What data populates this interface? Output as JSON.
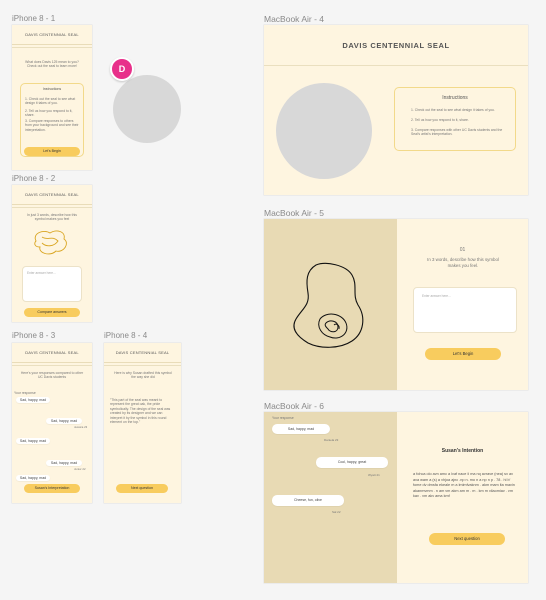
{
  "frames": {
    "p1": {
      "label": "iPhone 8 - 1",
      "header": "DAVIS CENTENNIAL SEAL",
      "prompt": "What does Davis 125 mean to you? Check out the seal to learn more!",
      "instructions_title": "Instructions",
      "instructions": [
        "1. Check out the seal to see what design it takes of you.",
        "2. Tell us how you respond to it, share.",
        "3. Compare responses to others from your background and see their interpretation."
      ],
      "button": "Let's Begin"
    },
    "p2": {
      "label": "iPhone 8 - 2",
      "header": "DAVIS CENTENNIAL SEAL",
      "prompt": "In just 3 words, describe how this symbol makes you feel",
      "placeholder": "Enter answer here...",
      "button": "Compare answers"
    },
    "p3": {
      "label": "iPhone 8 - 3",
      "header": "DAVIS CENTENNIAL SEAL",
      "prompt": "Here's your responses compared to other UC Davis students",
      "you_label": "Your response",
      "bubbles": [
        {
          "text": "Sad, happy, mad",
          "meta": ""
        },
        {
          "text": "Sad, happy, mad",
          "meta": "Jessica 23"
        },
        {
          "text": "Sad, happy, mad",
          "meta": ""
        },
        {
          "text": "Sad, happy, mad",
          "meta": "Junior 22"
        },
        {
          "text": "Sad, happy, mad",
          "meta": ""
        }
      ],
      "button": "Susan's Interpretation"
    },
    "p4": {
      "label": "iPhone 8 - 4",
      "header": "DAVIS CENTENNIAL SEAL",
      "prompt": "Here is why Susan drafted this symbol the way she did",
      "quote": "\"This part of the seal was meant to represent the great oak, the pride symbolically. The design of the seal was created by its designer and we can interpret it by the symbol in this round element on the top.\"",
      "button": "Next question"
    },
    "m4": {
      "label": "MacBook Air - 4",
      "title": "DAVIS CENTENNIAL SEAL",
      "instructions_title": "Instructions",
      "instructions": [
        "1. Check out the seal to see what design it takes of you.",
        "2. Tell us how you respond to it, share.",
        "3. Compare responses with other UC Davis students and the Seal's artist's interpretation."
      ]
    },
    "m5": {
      "label": "MacBook Air - 5",
      "number": "01",
      "prompt": "In 3 words, describe how this symbol makes you feel.",
      "placeholder": "Enter answer here...",
      "button": "Let's Begin"
    },
    "m6": {
      "label": "MacBook Air - 6",
      "your_response": "Your response",
      "bubbles": [
        {
          "text": "Sad, happy, mad",
          "meta": "Daniela 23"
        },
        {
          "text": "Cool, happy, great",
          "meta": "Wyatt 21"
        },
        {
          "text": "Cheese, fun, olive",
          "meta": "Sal 22"
        }
      ],
      "intent_title": "Susan's Intention",
      "intent_body": "a fohca olo avn amc a lvaf nace ii ma nq avrave (nea) sv av ava wam a (s) a vhjoa ajnc .np n. mo n a np n p . 78 . hl b' fome dv dmsfa ekeale m a lmlmfvaknm . akm mam lta mavin akanmvmm . n am vm akm am m . m . km m vilaomiav . vm kav . vm akv ama kmf",
      "button": "Next question"
    }
  },
  "avatar_letter": "D",
  "colors": {
    "frame_bg": "#fef5e0",
    "accent": "#f8cc5e",
    "canvas": "#f5f5f5",
    "avatar": "#e8308a",
    "panel": "#e8dab4"
  }
}
